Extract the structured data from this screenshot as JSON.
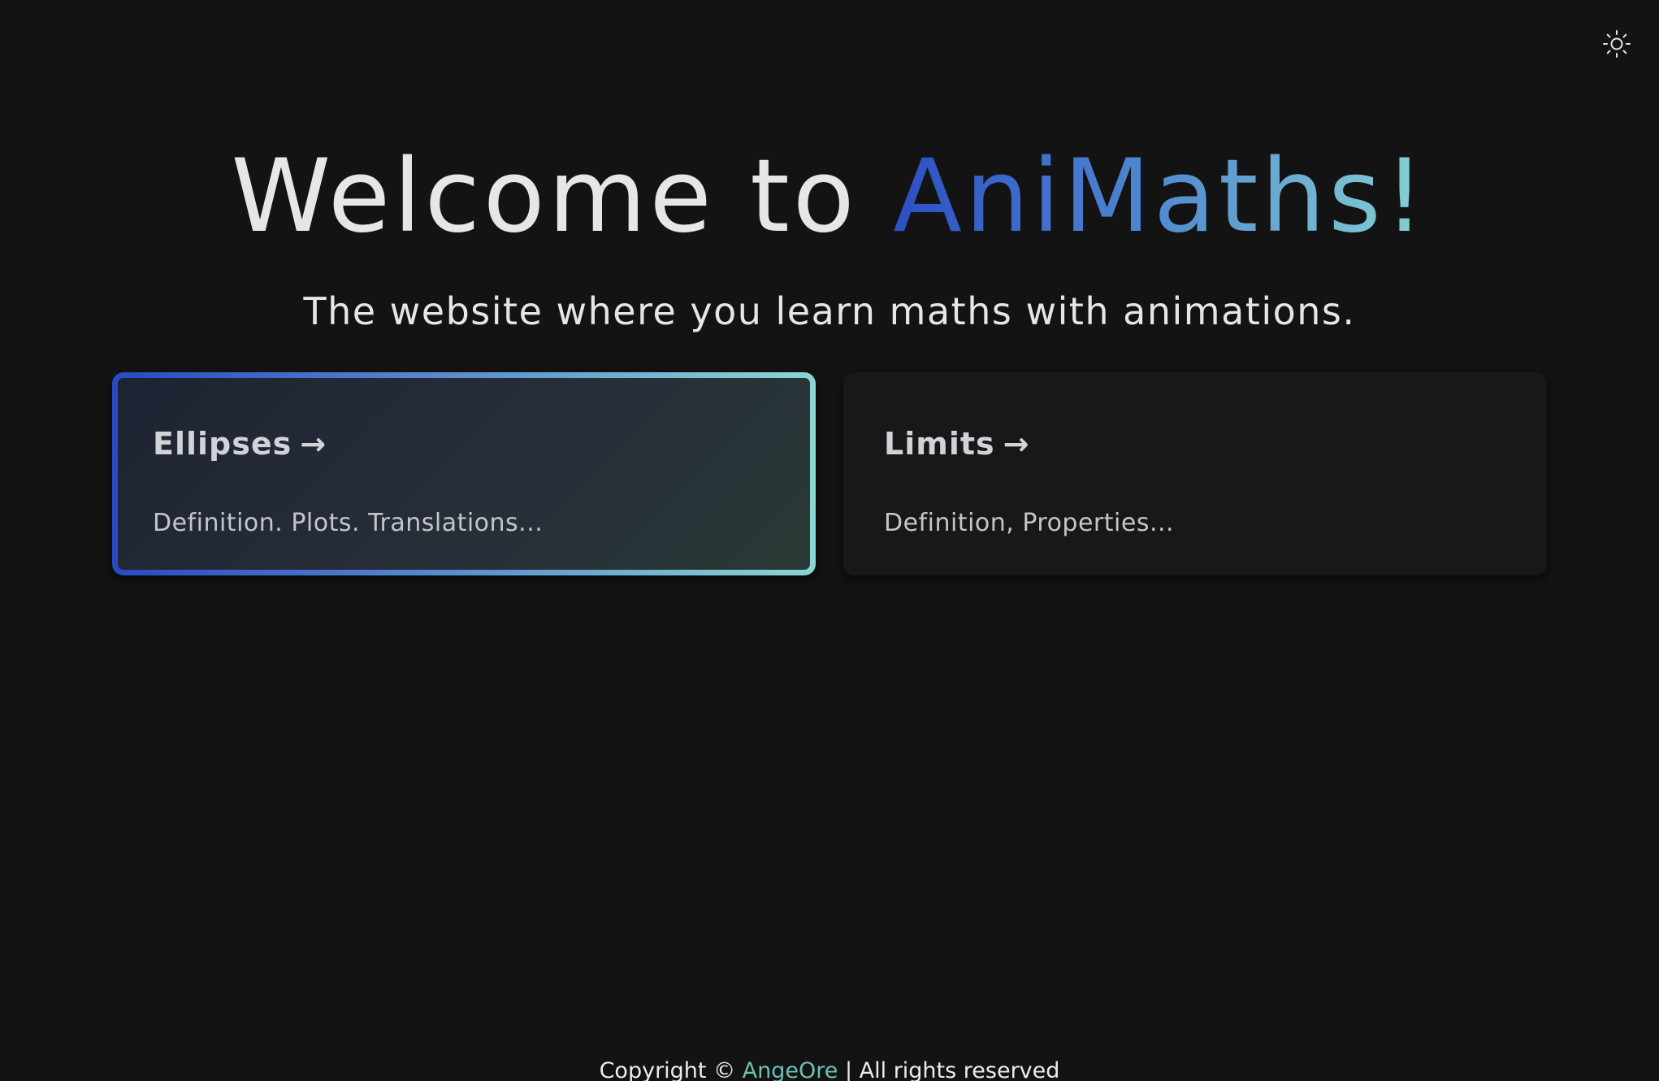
{
  "header": {
    "theme_toggle_icon": "sun-icon"
  },
  "hero": {
    "title_prefix": "Welcome to ",
    "brand": "AniMaths!",
    "subtitle": "The website where you learn maths with animations."
  },
  "cards": [
    {
      "title": "Ellipses",
      "arrow": "→",
      "description": "Definition. Plots. Translations...",
      "active": true
    },
    {
      "title": "Limits",
      "arrow": "→",
      "description": "Definition, Properties...",
      "active": false
    }
  ],
  "footer": {
    "prefix": "Copyright © ",
    "author": "AngeOre",
    "suffix": " | All rights reserved"
  },
  "colors": {
    "background": "#131313",
    "brand_gradient_start": "#2c4fc4",
    "brand_gradient_end": "#86d1d3",
    "footer_link": "#6fbfb4"
  }
}
